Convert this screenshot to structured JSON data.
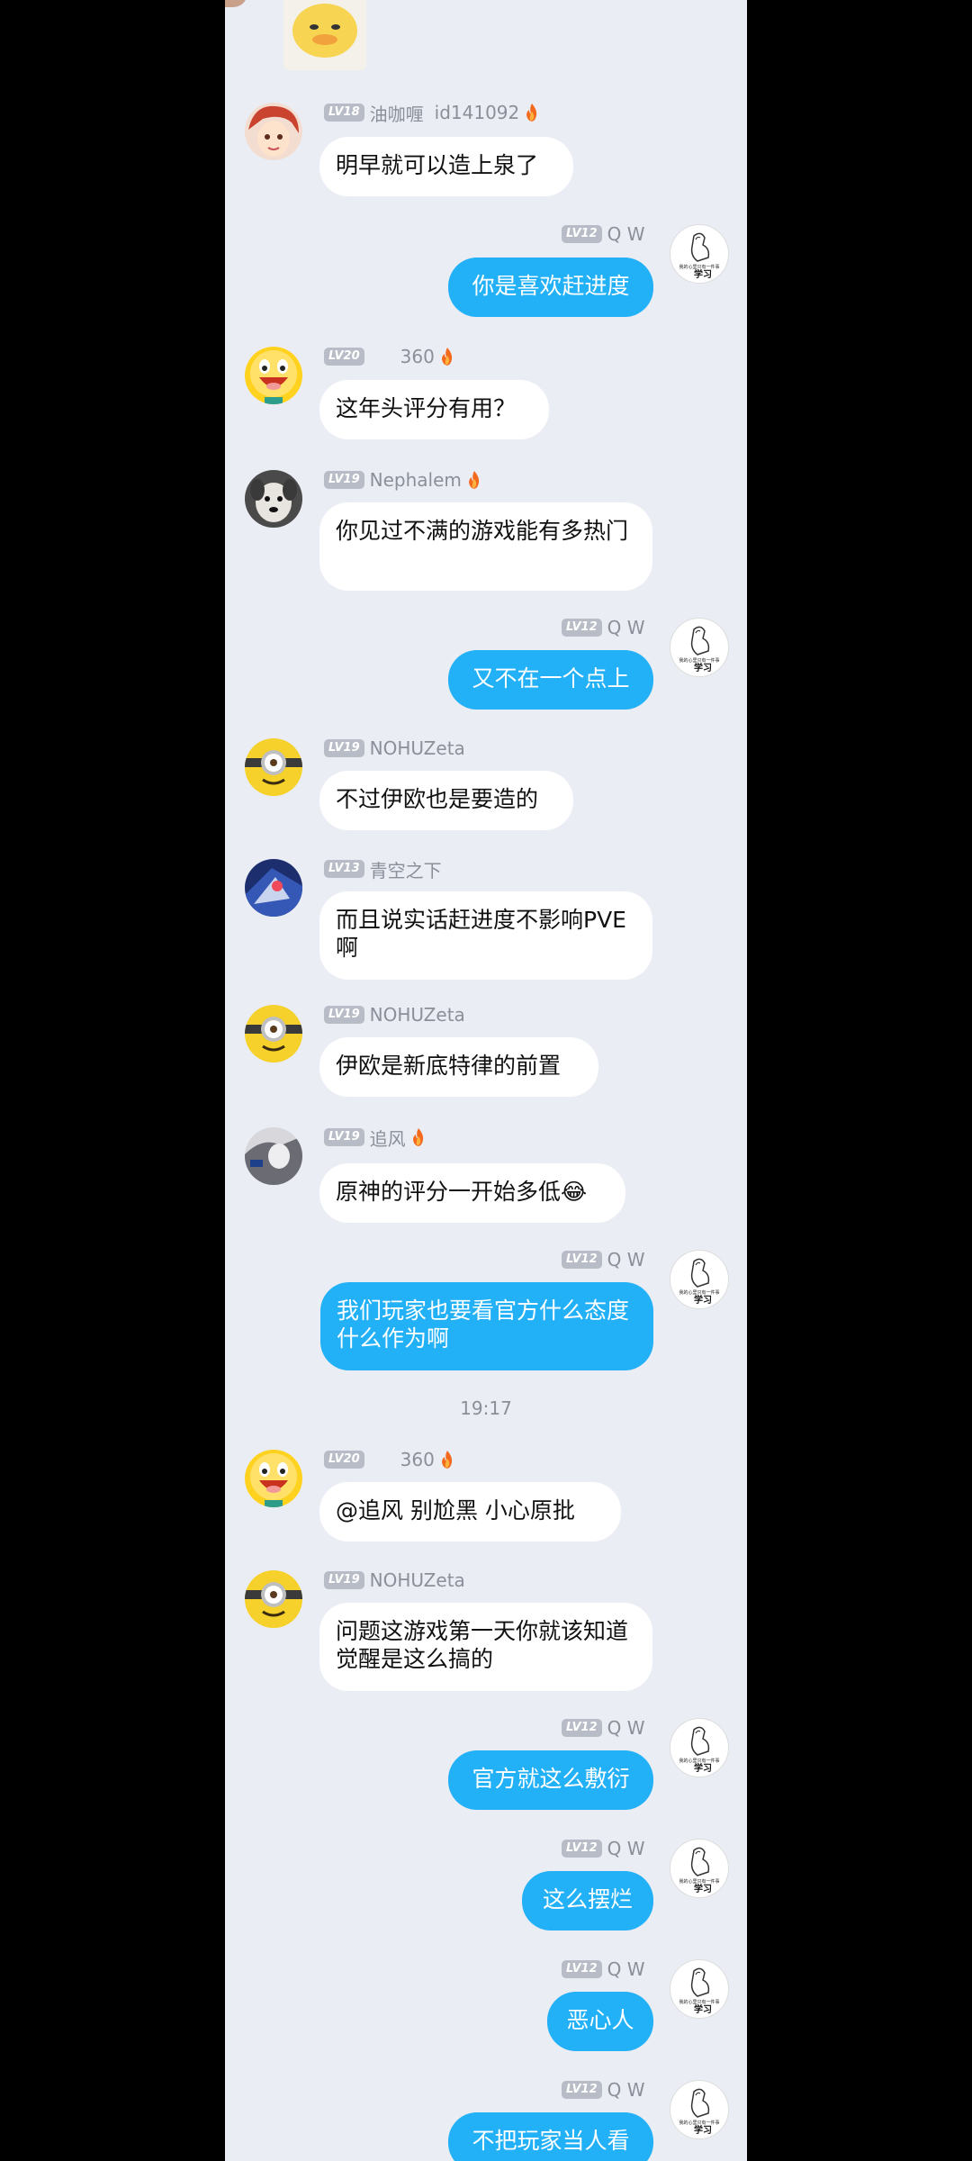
{
  "timestamp": "19:17",
  "sticker_name": "duck-sticker",
  "self": {
    "level": "LV12",
    "name": "Q W",
    "avatar_text_small": "我的心里只有一件事",
    "avatar_text_big": "学习"
  },
  "messages": [
    {
      "dir": "in",
      "avatar": "red-hair",
      "level": "LV18",
      "name": "油咖喱",
      "extra": "id141092",
      "fire": true,
      "text": "明早就可以造上泉了"
    },
    {
      "dir": "out",
      "text": "你是喜欢赶进度"
    },
    {
      "dir": "in",
      "avatar": "smiley",
      "level": "LV20",
      "name": "360",
      "extra": "",
      "fire": true,
      "text": "这年头评分有用？"
    },
    {
      "dir": "in",
      "avatar": "dog",
      "level": "LV19",
      "name": "Nephalem",
      "extra": "",
      "fire": true,
      "text": "你见过不满的游戏能有多热门"
    },
    {
      "dir": "out",
      "text": "又不在一个点上"
    },
    {
      "dir": "in",
      "avatar": "minion",
      "level": "LV19",
      "name": "NOHUZeta",
      "extra": "",
      "fire": false,
      "text": "不过伊欧也是要造的"
    },
    {
      "dir": "in",
      "avatar": "mech",
      "level": "LV13",
      "name": "青空之下",
      "extra": "",
      "fire": false,
      "text": "而且说实话赶进度不影响PVE啊"
    },
    {
      "dir": "in",
      "avatar": "minion",
      "level": "LV19",
      "name": "NOHUZeta",
      "extra": "",
      "fire": false,
      "text": "伊欧是新底特律的前置"
    },
    {
      "dir": "in",
      "avatar": "gray-figure",
      "level": "LV19",
      "name": "追风",
      "extra": "",
      "fire": true,
      "text": "原神的评分一开始多低😂"
    },
    {
      "dir": "out",
      "text": "我们玩家也要看官方什么态度  什么作为啊"
    },
    {
      "dir": "in",
      "avatar": "smiley",
      "level": "LV20",
      "name": "360",
      "extra": "",
      "fire": true,
      "text": "@追风  别尬黑  小心原批"
    },
    {
      "dir": "in",
      "avatar": "minion",
      "level": "LV19",
      "name": "NOHUZeta",
      "extra": "",
      "fire": false,
      "text": "问题这游戏第一天你就该知道觉醒是这么搞的"
    },
    {
      "dir": "out",
      "text": "官方就这么敷衍"
    },
    {
      "dir": "out",
      "text": "这么摆烂"
    },
    {
      "dir": "out",
      "text": "恶心人"
    },
    {
      "dir": "out",
      "text": "不把玩家当人看"
    }
  ]
}
